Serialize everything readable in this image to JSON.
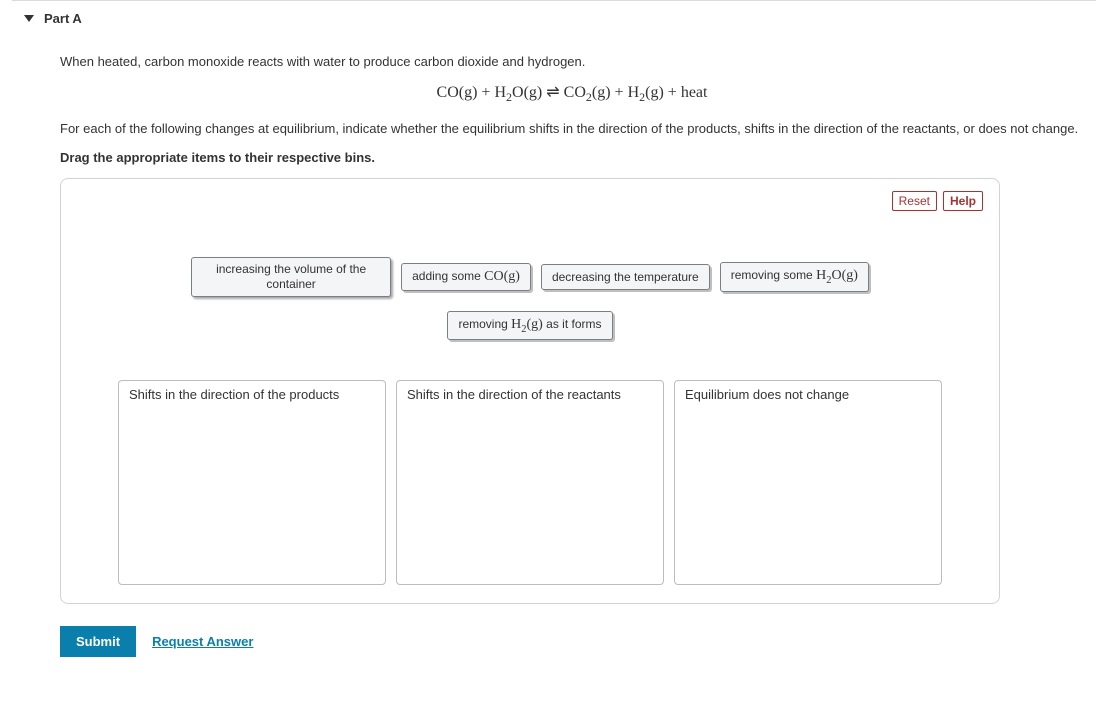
{
  "part": {
    "label": "Part A"
  },
  "intro": "When heated, carbon monoxide reacts with water to produce carbon dioxide and hydrogen.",
  "equation": {
    "lhs1": "CO(g)",
    "plus": "+",
    "lhs2": "H",
    "lhs2_sub": "2",
    "lhs2_tail": "O(g)",
    "arrows": "⇌",
    "rhs1": "CO",
    "rhs1_sub": "2",
    "rhs1_tail": "(g)",
    "rhs2": "H",
    "rhs2_sub": "2",
    "rhs2_tail": "(g)",
    "heat": "heat"
  },
  "prompt": "For each of the following changes at equilibrium, indicate whether the equilibrium shifts in the direction of the products, shifts in the direction of the reactants, or does not change.",
  "instruction": "Drag the appropriate items to their respective bins.",
  "toolbar": {
    "reset": "Reset",
    "help": "Help"
  },
  "items": {
    "i1": "increasing the volume of the container",
    "i2_pre": "adding some ",
    "i2_chem": "CO(g)",
    "i3": "decreasing the temperature",
    "i4_pre": "removing some ",
    "i4_chem_a": "H",
    "i4_chem_sub": "2",
    "i4_chem_b": "O(g)",
    "i5_pre": "removing ",
    "i5_chem_a": "H",
    "i5_chem_sub": "2",
    "i5_chem_b": "(g)",
    "i5_post": " as it forms"
  },
  "bins": {
    "b1": "Shifts in the direction of the products",
    "b2": "Shifts in the direction of the reactants",
    "b3": "Equilibrium does not change"
  },
  "actions": {
    "submit": "Submit",
    "request": "Request Answer"
  }
}
